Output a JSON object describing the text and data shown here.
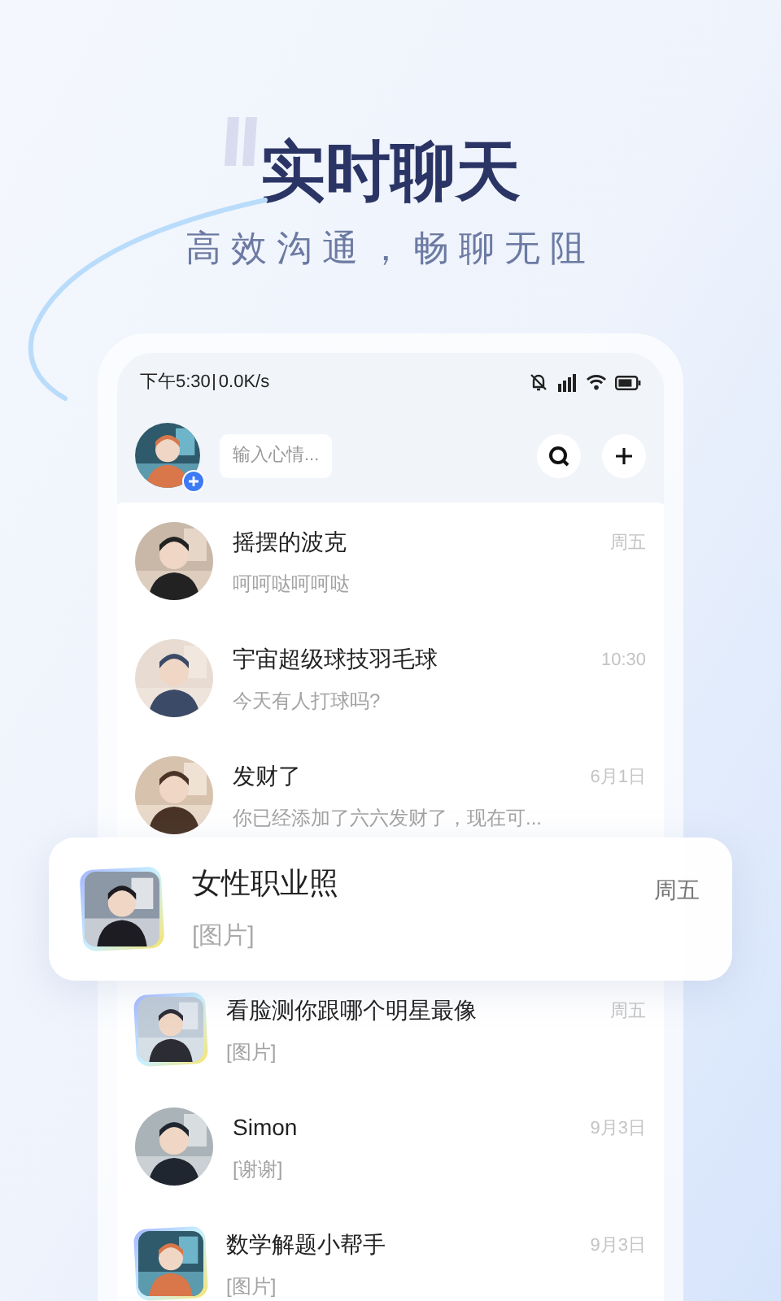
{
  "hero": {
    "title": "实时聊天",
    "subtitle": "高效沟通，畅聊无阻"
  },
  "status_bar": {
    "time": "下午5:30",
    "speed": "0.0K/s"
  },
  "header": {
    "mood_placeholder": "输入心情..."
  },
  "chats": [
    {
      "name": "摇摆的波克",
      "preview": "呵呵哒呵呵哒",
      "time": "周五",
      "kind": "circle"
    },
    {
      "name": "宇宙超级球技羽毛球",
      "preview": "今天有人打球吗?",
      "time": "10:30",
      "kind": "circle"
    },
    {
      "name": "发财了",
      "preview": "你已经添加了六六发财了，现在可...",
      "time": "6月1日",
      "kind": "circle"
    },
    {
      "name": "看脸测你跟哪个明星最像",
      "preview": "[图片]",
      "time": "周五",
      "kind": "square"
    },
    {
      "name": "Simon",
      "preview": "[谢谢]",
      "time": "9月3日",
      "kind": "circle"
    },
    {
      "name": "数学解题小帮手",
      "preview": "[图片]",
      "time": "9月3日",
      "kind": "square"
    }
  ],
  "featured_chat": {
    "name": "女性职业照",
    "preview": "[图片]",
    "time": "周五",
    "kind": "square"
  }
}
